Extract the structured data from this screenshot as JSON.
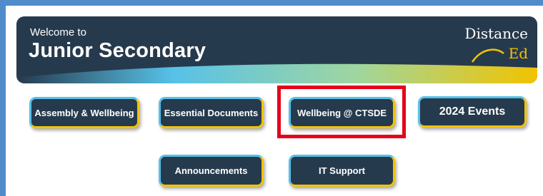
{
  "banner": {
    "welcome": "Welcome to",
    "title": "Junior Secondary",
    "logo": {
      "line1": "Distance",
      "line2": "Ed"
    }
  },
  "buttons": {
    "assembly": "Assembly & Wellbeing",
    "documents": "Essential Documents",
    "wellbeing": "Wellbeing @ CTSDE",
    "events": "2024 Events",
    "announcements": "Announcements",
    "it_support": "IT Support"
  },
  "colors": {
    "page_border": "#4f8cc9",
    "banner_bg": "#263a4d",
    "button_bg": "#263a4d",
    "accent_blue": "#57c1e8",
    "accent_yellow": "#f2c300",
    "highlight_red": "#e3051b"
  }
}
